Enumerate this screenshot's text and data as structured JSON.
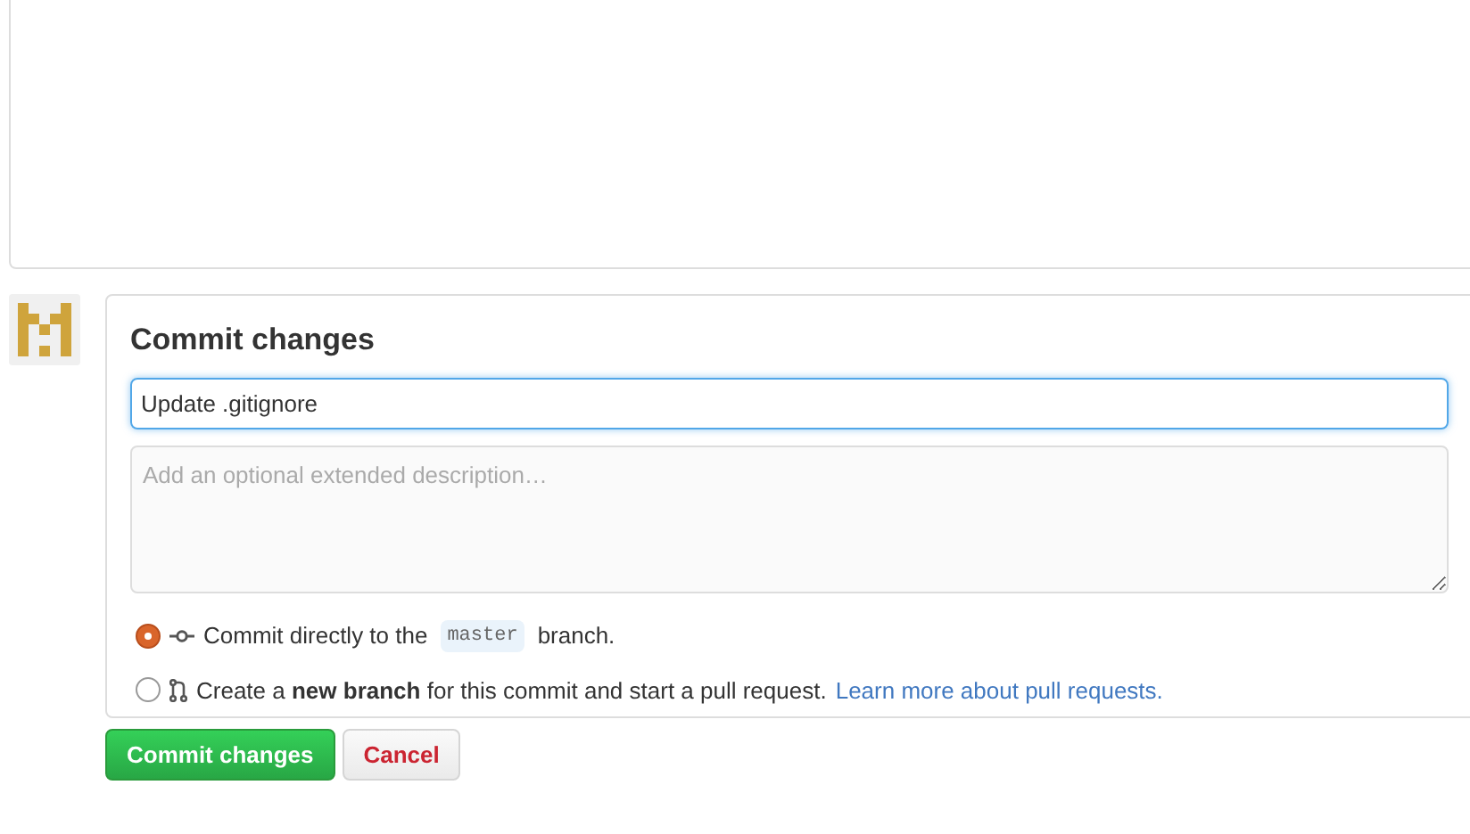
{
  "commit": {
    "title": "Commit changes",
    "summary": {
      "value": "Update .gitignore"
    },
    "description": {
      "placeholder": "Add an optional extended description…"
    },
    "options": [
      {
        "kind": "direct",
        "selected": true,
        "text_before": "Commit directly to the",
        "branch": "master",
        "text_after": "branch."
      },
      {
        "kind": "pull",
        "selected": false,
        "text": "Create a **new branch** for this commit and start a pull request.",
        "link": "Learn more about pull requests."
      }
    ],
    "buttons": [
      {
        "kind": "primary",
        "label": "Commit changes"
      },
      {
        "kind": "cancel",
        "label": "Cancel"
      }
    ]
  }
}
